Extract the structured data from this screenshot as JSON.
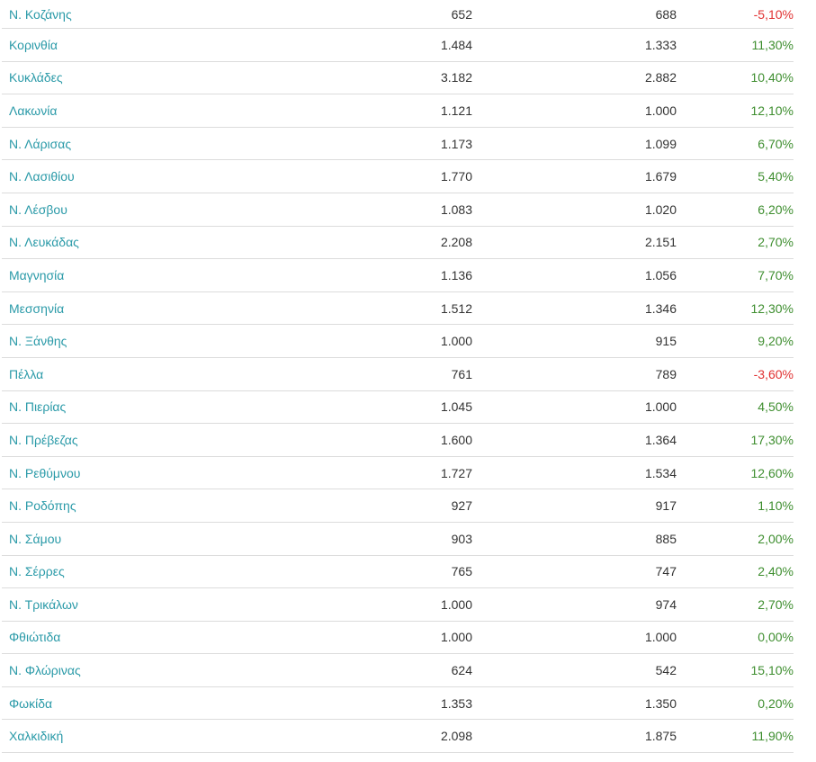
{
  "rows": [
    {
      "name": "Ν. Κοζάνης",
      "v1": "652",
      "v2": "688",
      "pct": "-5,10%",
      "sign": "neg"
    },
    {
      "name": "Κορινθία",
      "v1": "1.484",
      "v2": "1.333",
      "pct": "11,30%",
      "sign": "pos"
    },
    {
      "name": "Κυκλάδες",
      "v1": "3.182",
      "v2": "2.882",
      "pct": "10,40%",
      "sign": "pos"
    },
    {
      "name": "Λακωνία",
      "v1": "1.121",
      "v2": "1.000",
      "pct": "12,10%",
      "sign": "pos"
    },
    {
      "name": "Ν. Λάρισας",
      "v1": "1.173",
      "v2": "1.099",
      "pct": "6,70%",
      "sign": "pos"
    },
    {
      "name": "Ν. Λασιθίου",
      "v1": "1.770",
      "v2": "1.679",
      "pct": "5,40%",
      "sign": "pos"
    },
    {
      "name": "Ν. Λέσβου",
      "v1": "1.083",
      "v2": "1.020",
      "pct": "6,20%",
      "sign": "pos"
    },
    {
      "name": "Ν. Λευκάδας",
      "v1": "2.208",
      "v2": "2.151",
      "pct": "2,70%",
      "sign": "pos"
    },
    {
      "name": "Μαγνησία",
      "v1": "1.136",
      "v2": "1.056",
      "pct": "7,70%",
      "sign": "pos"
    },
    {
      "name": "Μεσσηνία",
      "v1": "1.512",
      "v2": "1.346",
      "pct": "12,30%",
      "sign": "pos"
    },
    {
      "name": "Ν. Ξάνθης",
      "v1": "1.000",
      "v2": "915",
      "pct": "9,20%",
      "sign": "pos"
    },
    {
      "name": "Πέλλα",
      "v1": "761",
      "v2": "789",
      "pct": "-3,60%",
      "sign": "neg"
    },
    {
      "name": "Ν. Πιερίας",
      "v1": "1.045",
      "v2": "1.000",
      "pct": "4,50%",
      "sign": "pos"
    },
    {
      "name": "Ν. Πρέβεζας",
      "v1": "1.600",
      "v2": "1.364",
      "pct": "17,30%",
      "sign": "pos"
    },
    {
      "name": "Ν. Ρεθύμνου",
      "v1": "1.727",
      "v2": "1.534",
      "pct": "12,60%",
      "sign": "pos"
    },
    {
      "name": "Ν. Ροδόπης",
      "v1": "927",
      "v2": "917",
      "pct": "1,10%",
      "sign": "pos"
    },
    {
      "name": "Ν. Σάμου",
      "v1": "903",
      "v2": "885",
      "pct": "2,00%",
      "sign": "pos"
    },
    {
      "name": "Ν. Σέρρες",
      "v1": "765",
      "v2": "747",
      "pct": "2,40%",
      "sign": "pos"
    },
    {
      "name": "Ν. Τρικάλων",
      "v1": "1.000",
      "v2": "974",
      "pct": "2,70%",
      "sign": "pos"
    },
    {
      "name": "Φθιώτιδα",
      "v1": "1.000",
      "v2": "1.000",
      "pct": "0,00%",
      "sign": "pos"
    },
    {
      "name": "Ν. Φλώρινας",
      "v1": "624",
      "v2": "542",
      "pct": "15,10%",
      "sign": "pos"
    },
    {
      "name": "Φωκίδα",
      "v1": "1.353",
      "v2": "1.350",
      "pct": "0,20%",
      "sign": "pos"
    },
    {
      "name": "Χαλκιδική",
      "v1": "2.098",
      "v2": "1.875",
      "pct": "11,90%",
      "sign": "pos"
    }
  ],
  "colors": {
    "link": "#2a9aa8",
    "positive": "#3e8e2f",
    "negative": "#e03131",
    "divider": "#dcdcdc"
  }
}
